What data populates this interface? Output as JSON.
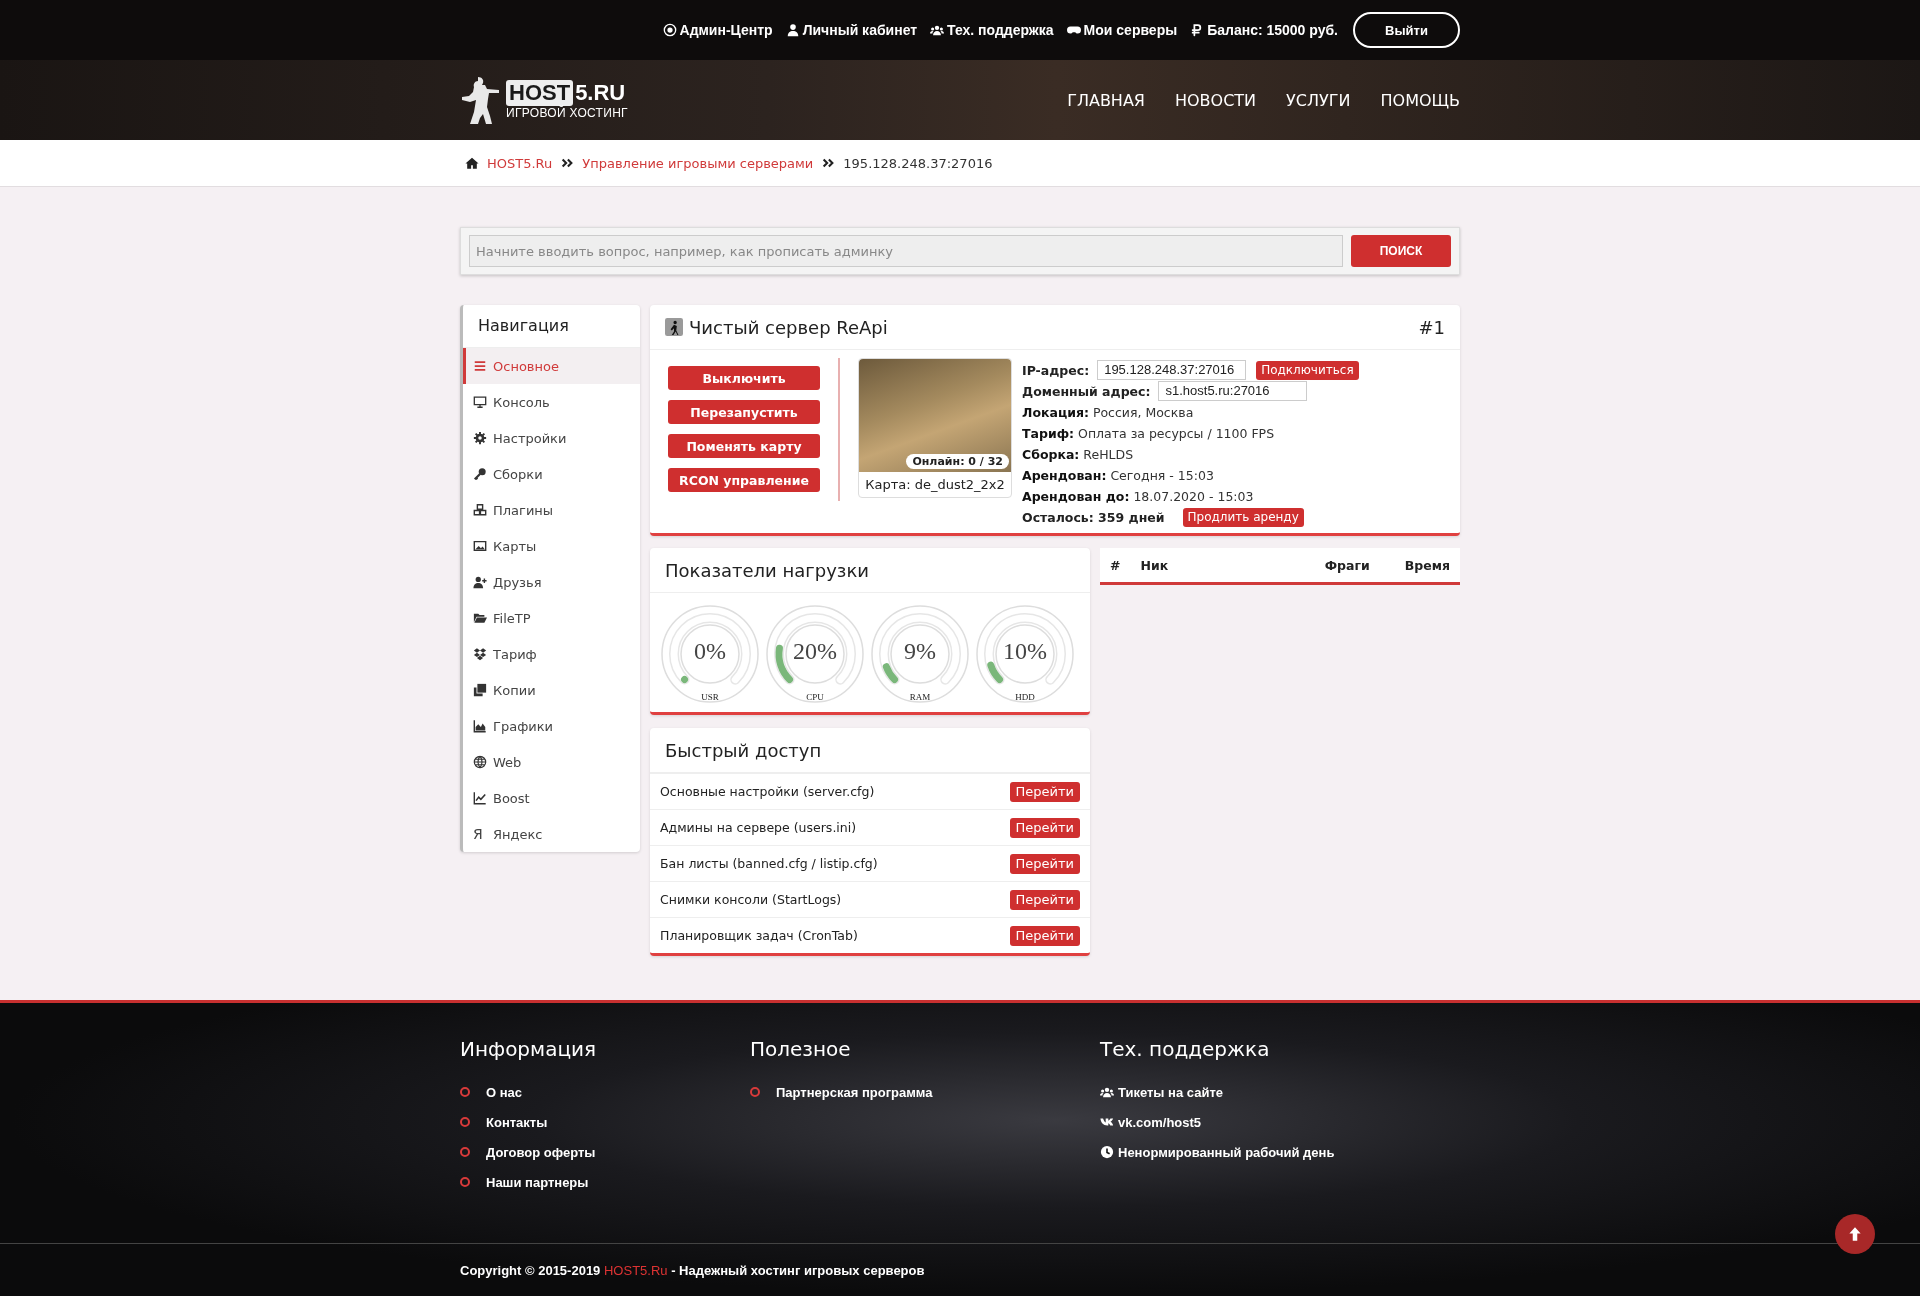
{
  "top_links": [
    {
      "label": "Админ-Центр"
    },
    {
      "label": "Личный кабинет"
    },
    {
      "label": "Тех. поддержка"
    },
    {
      "label": "Мои серверы"
    },
    {
      "label": "Баланс: 15000 руб."
    }
  ],
  "logout_button": "Выйти",
  "logo": {
    "box": "HOST",
    "rest": "5.RU",
    "tagline": "ИГРОВОЙ ХОСТИНГ"
  },
  "main_nav": [
    "ГЛАВНАЯ",
    "НОВОСТИ",
    "УСЛУГИ",
    "ПОМОЩЬ"
  ],
  "breadcrumb": {
    "links": [
      "HOST5.Ru",
      "Управление игровыми серверами"
    ],
    "current": "195.128.248.37:27016"
  },
  "search": {
    "placeholder": "Начните вводить вопрос, например, как прописать админку",
    "button": "ПОИСК"
  },
  "sidebar": {
    "title": "Навигация",
    "items": [
      {
        "label": "Основное",
        "selected": true
      },
      {
        "label": "Консоль",
        "selected": false
      },
      {
        "label": "Настройки",
        "selected": false
      },
      {
        "label": "Сборки",
        "selected": false
      },
      {
        "label": "Плагины",
        "selected": false
      },
      {
        "label": "Карты",
        "selected": false
      },
      {
        "label": "Друзья",
        "selected": false
      },
      {
        "label": "FileTP",
        "selected": false
      },
      {
        "label": "Тариф",
        "selected": false
      },
      {
        "label": "Копии",
        "selected": false
      },
      {
        "label": "Графики",
        "selected": false
      },
      {
        "label": "Web",
        "selected": false
      },
      {
        "label": "Boost",
        "selected": false
      },
      {
        "label": "Яндекс",
        "selected": false,
        "glyph": "Я"
      }
    ]
  },
  "server": {
    "title": "Чистый сервер ReApi",
    "number": "#1",
    "buttons": [
      "Выключить",
      "Перезапустить",
      "Поменять карту",
      "RCON управление"
    ],
    "online": "Онлайн: 0 / 32",
    "map_caption": "Карта: de_dust2_2x2",
    "info": [
      {
        "kind": "field",
        "label": "IP-адрес:",
        "value": "195.128.248.37:27016",
        "action": "Подключиться"
      },
      {
        "kind": "field",
        "label": "Доменный адрес:",
        "value": "s1.host5.ru:27016"
      },
      {
        "kind": "text",
        "label": "Локация:",
        "value": "Россия, Москва"
      },
      {
        "kind": "text",
        "label": "Тариф:",
        "value": "Оплата за ресурсы / 1100 FPS"
      },
      {
        "kind": "text",
        "label": "Сборка:",
        "value": "ReHLDS"
      },
      {
        "kind": "text",
        "label": "Арендован:",
        "value": "Сегодня - 15:03"
      },
      {
        "kind": "text",
        "label": "Арендован до:",
        "value": "18.07.2020 - 15:03"
      },
      {
        "kind": "bold",
        "label": "Осталось: 359 дней",
        "action": "Продлить аренду"
      }
    ]
  },
  "load": {
    "title": "Показатели нагрузки",
    "gauges": [
      {
        "name": "USR",
        "reading": "0%",
        "level": 0
      },
      {
        "name": "CPU",
        "reading": "20%",
        "level": 0.2
      },
      {
        "name": "RAM",
        "reading": "9%",
        "level": 0.09
      },
      {
        "name": "HDD",
        "reading": "10%",
        "level": 0.1
      }
    ]
  },
  "players": {
    "columns": [
      "#",
      "Ник",
      "Фраги",
      "Время"
    ]
  },
  "quick_access": {
    "title": "Быстрый доступ",
    "rows": [
      {
        "label": "Основные настройки (server.cfg)",
        "button": "Перейти"
      },
      {
        "label": "Админы на сервере (users.ini)",
        "button": "Перейти"
      },
      {
        "label": "Бан листы (banned.cfg / listip.cfg)",
        "button": "Перейти"
      },
      {
        "label": "Снимки консоли (StartLogs)",
        "button": "Перейти"
      },
      {
        "label": "Планировщик задач (CronTab)",
        "button": "Перейти"
      }
    ]
  },
  "footer": {
    "columns": [
      {
        "title": "Информация",
        "kind": "bullets",
        "links": [
          "О нас",
          "Контакты",
          "Договор оферты",
          "Наши партнеры"
        ]
      },
      {
        "title": "Полезное",
        "kind": "bullets",
        "links": [
          "Партнерская программа"
        ]
      },
      {
        "title": "Тех. поддержка",
        "kind": "icons",
        "links": [
          "Тикеты на сайте",
          "vk.com/host5",
          "Ненормированный рабочий день"
        ]
      }
    ],
    "copyright": {
      "prefix": "Copyright © 2015-2019",
      "brand": "HOST5.Ru",
      "suffix": "- Надежный хостинг игровых серверов"
    }
  }
}
